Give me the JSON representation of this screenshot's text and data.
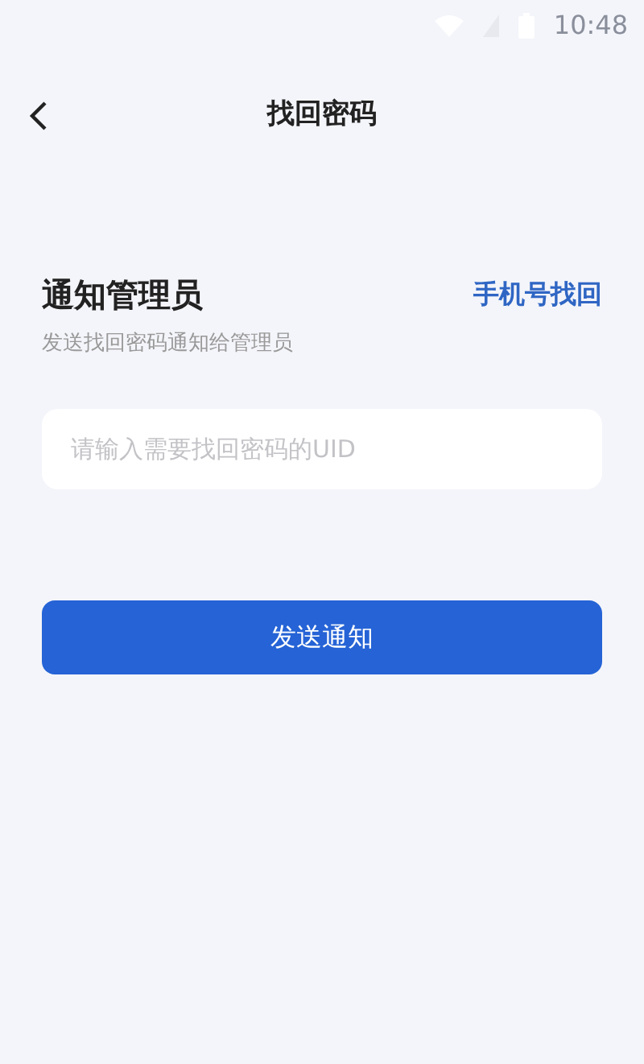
{
  "status_bar": {
    "time": "10:48"
  },
  "header": {
    "title": "找回密码"
  },
  "section": {
    "title": "通知管理员",
    "subtitle": "发送找回密码通知给管理员",
    "link": "手机号找回"
  },
  "uid_field": {
    "placeholder": "请输入需要找回密码的UID"
  },
  "submit_button": {
    "label": "发送通知"
  }
}
